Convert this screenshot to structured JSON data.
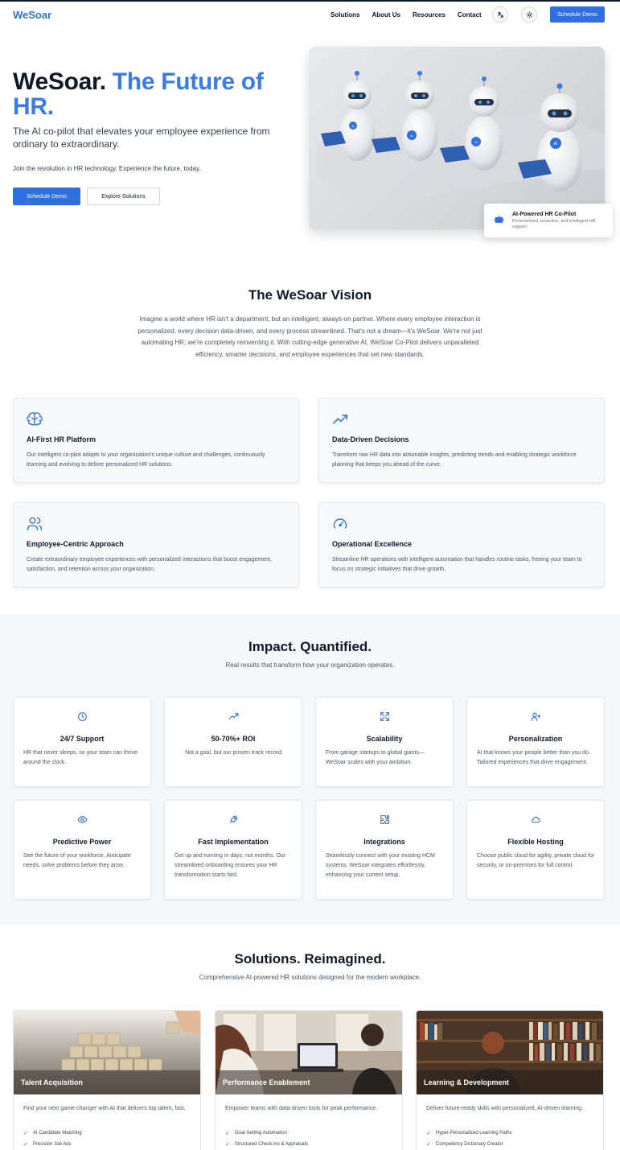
{
  "nav": {
    "logo": "WeSoar",
    "links": [
      "Solutions",
      "About Us",
      "Resources",
      "Contact"
    ],
    "cta": "Schedule Demo",
    "translate_icon": "translate-icon",
    "theme_icon": "sun-icon"
  },
  "hero": {
    "title_main": "WeSoar.",
    "title_accent": "The Future of HR.",
    "subtitle": "The AI co-pilot that elevates your employee experience from ordinary to extraordinary.",
    "tagline": "Join the revolution in HR technology. Experience the future, today.",
    "primary_button": "Schedule Demo",
    "secondary_button": "Explore Solutions",
    "badge_title": "AI-Powered HR Co-Pilot",
    "badge_desc": "Personalized, proactive, and intelligent HR support",
    "robot_label": "AI"
  },
  "vision": {
    "title": "The WeSoar Vision",
    "text": "Imagine a world where HR isn't a department, but an intelligent, always-on partner. Where every employee interaction is personalized, every decision data-driven, and every process streamlined. That's not a dream—it's WeSoar. We're not just automating HR; we're completely reinventing it. With cutting-edge generative AI, WeSoar Co-Pilot delivers unparalleled efficiency, smarter decisions, and employee experiences that set new standards.",
    "cards": [
      {
        "icon": "brain-icon",
        "title": "AI-First HR Platform",
        "desc": "Our intelligent co-pilot adapts to your organization's unique culture and challenges, continuously learning and evolving to deliver personalized HR solutions."
      },
      {
        "icon": "trending-up-icon",
        "title": "Data-Driven Decisions",
        "desc": "Transform raw HR data into actionable insights, predicting trends and enabling strategic workforce planning that keeps you ahead of the curve."
      },
      {
        "icon": "users-icon",
        "title": "Employee-Centric Approach",
        "desc": "Create extraordinary employee experiences with personalized interactions that boost engagement, satisfaction, and retention across your organization."
      },
      {
        "icon": "gauge-icon",
        "title": "Operational Excellence",
        "desc": "Streamline HR operations with intelligent automation that handles routine tasks, freeing your team to focus on strategic initiatives that drive growth."
      }
    ]
  },
  "impact": {
    "title": "Impact. Quantified.",
    "subtitle": "Real results that transform how your organization operates.",
    "cards": [
      {
        "icon": "clock-icon",
        "title": "24/7 Support",
        "desc": "HR that never sleeps, so your team can thrive around the clock."
      },
      {
        "icon": "trending-up-icon",
        "title": "50-70%+ ROI",
        "desc": "Not a goal, but our proven track record."
      },
      {
        "icon": "expand-icon",
        "title": "Scalability",
        "desc": "From garage startups to global giants—WeSoar scales with your ambition."
      },
      {
        "icon": "user-plus-icon",
        "title": "Personalization",
        "desc": "AI that knows your people better than you do. Tailored experiences that drive engagement."
      },
      {
        "icon": "eye-icon",
        "title": "Predictive Power",
        "desc": "See the future of your workforce. Anticipate needs, solve problems before they arise."
      },
      {
        "icon": "rocket-icon",
        "title": "Fast Implementation",
        "desc": "Get up and running in days, not months. Our streamlined onboarding ensures your HR transformation starts fast."
      },
      {
        "icon": "puzzle-icon",
        "title": "Integrations",
        "desc": "Seamlessly connect with your existing HCM systems. WeSoar integrates effortlessly, enhancing your current setup."
      },
      {
        "icon": "cloud-icon",
        "title": "Flexible Hosting",
        "desc": "Choose public cloud for agility, private cloud for security, or on-premises for full control."
      }
    ]
  },
  "solutions": {
    "title": "Solutions. Reimagined.",
    "subtitle": "Comprehensive AI-powered HR solutions designed for the modern workplace.",
    "cards": [
      {
        "title": "Talent Acquisition",
        "desc": "Find your next game-changer with AI that delivers top talent, fast.",
        "features": [
          "AI Candidate Matching",
          "Precision Job Ads"
        ]
      },
      {
        "title": "Performance Enablement",
        "desc": "Empower teams with data-driven tools for peak performance.",
        "features": [
          "Goal-Setting Automation",
          "Structured Check-ins & Appraisals"
        ]
      },
      {
        "title": "Learning & Development",
        "desc": "Deliver future-ready skills with personalized, AI-driven learning.",
        "features": [
          "Hyper-Personalized Learning Paths",
          "Competency Dictionary Creator"
        ]
      }
    ]
  },
  "colors": {
    "accent": "#2f6fe0",
    "heading": "#111827",
    "body": "#4b5563"
  }
}
